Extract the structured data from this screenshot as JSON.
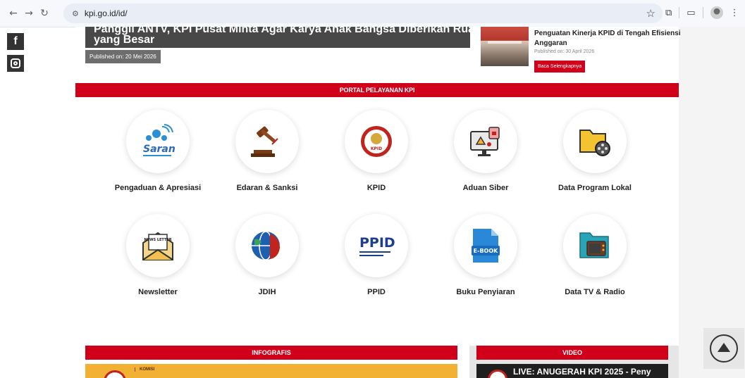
{
  "browser": {
    "url": "kpi.go.id/id/",
    "back_glyph": "←",
    "forward_glyph": "→",
    "reload_glyph": "↻",
    "tune_glyph": "⚙",
    "star_glyph": "☆",
    "extensions_glyph": "⧉",
    "tab_search_glyph": "▭",
    "menu_glyph": "⋮"
  },
  "social": {
    "facebook_glyph": "f"
  },
  "hero": {
    "title": "Panggil ANTV, KPI Pusat Minta Agar Karya Anak Bangsa Diberikan Ruang yang Besar",
    "date": "Published on: 20 Mei 2026"
  },
  "side_news": {
    "title": "Penguatan Kinerja KPID di Tengah Efisiensi Anggaran",
    "date": "Published on: 30 April 2026",
    "read_more": "Baca Selengkapnya"
  },
  "portal": {
    "title": "PORTAL PELAYANAN KPI",
    "services": [
      {
        "label": "Pengaduan & Apresiasi",
        "icon": "saran-icon",
        "logo_text": "Saran"
      },
      {
        "label": "Edaran & Sanksi",
        "icon": "gavel-icon"
      },
      {
        "label": "KPID",
        "icon": "kpid-emblem-icon",
        "logo_text": "KPID"
      },
      {
        "label": "Aduan Siber",
        "icon": "cyber-alert-icon"
      },
      {
        "label": "Data Program Lokal",
        "icon": "folder-film-icon"
      },
      {
        "label": "Newsletter",
        "icon": "newsletter-icon",
        "logo_text": "NEWS LETTER"
      },
      {
        "label": "JDIH",
        "icon": "jdih-globe-icon"
      },
      {
        "label": "PPID",
        "icon": "ppid-icon",
        "logo_text": "PPID"
      },
      {
        "label": "Buku Penyiaran",
        "icon": "ebook-icon",
        "logo_text": "E-BOOK"
      },
      {
        "label": "Data TV & Radio",
        "icon": "tv-radio-folder-icon"
      }
    ]
  },
  "infografis": {
    "title": "INFOGRAFIS",
    "komisi": "KOMISI"
  },
  "video": {
    "title": "VIDEO",
    "live_title": "LIVE: ANUGERAH KPI 2025 - Peny"
  },
  "colors": {
    "brand_red": "#d0001a",
    "text": "#222222"
  }
}
